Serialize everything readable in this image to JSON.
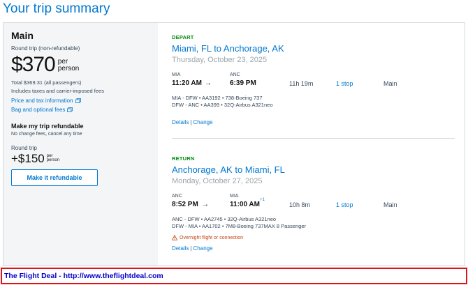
{
  "page": {
    "title": "Your trip summary"
  },
  "summary": {
    "fare_name": "Main",
    "fare_type": "Round trip (non-refundable)",
    "price": "$370",
    "price_per": [
      "per",
      "person"
    ],
    "total": "Total $369.31 (all passengers)",
    "includes": "Includes taxes and carrier-imposed fees",
    "price_link": "Price and tax information",
    "bag_link": "Bag and optional fees",
    "refund_title": "Make my trip refundable",
    "refund_sub": "No change fees, cancel any time",
    "refund_rt": "Round trip",
    "refund_price": "+$150",
    "refund_per": [
      "per",
      "person"
    ],
    "refund_button": "Make it refundable"
  },
  "legs": [
    {
      "label": "DEPART",
      "route": "Miami, FL to Anchorage, AK",
      "date": "Thursday, October 23, 2025",
      "origin_code": "MIA",
      "dest_code": "ANC",
      "depart_time": "11:20 AM",
      "arrow": "→",
      "arrive_time": "6:39 PM",
      "day_offset": "",
      "duration": "11h 19m",
      "stops": "1 stop",
      "cabin": "Main",
      "segments": [
        "MIA - DFW • AA3192 • 738-Boeing 737",
        "DFW - ANC • AA399 • 32Q-Airbus A321neo"
      ],
      "warning": "",
      "details": "Details",
      "change": "Change",
      "separator": "|"
    },
    {
      "label": "RETURN",
      "route": "Anchorage, AK to Miami, FL",
      "date": "Monday, October 27, 2025",
      "origin_code": "ANC",
      "dest_code": "MIA",
      "depart_time": "8:52 PM",
      "arrow": "→",
      "arrive_time": "11:00 AM",
      "day_offset": "+1",
      "duration": "10h 8m",
      "stops": "1 stop",
      "cabin": "Main",
      "segments": [
        "ANC - DFW • AA2745 • 32Q-Airbus A321neo",
        "DFW - MIA • AA1702 • 7M8-Boeing 737MAX 8 Passenger"
      ],
      "warning": "Overnight flight or connection",
      "details": "Details",
      "change": "Change",
      "separator": "|"
    }
  ],
  "footer": {
    "text": "The Flight Deal - http://www.theflightdeal.com"
  },
  "colors": {
    "link": "#0078d2",
    "leg_label": "#008a0e",
    "warning": "#c3420f",
    "footer_border": "#e0131a",
    "footer_text": "#0000cc"
  }
}
